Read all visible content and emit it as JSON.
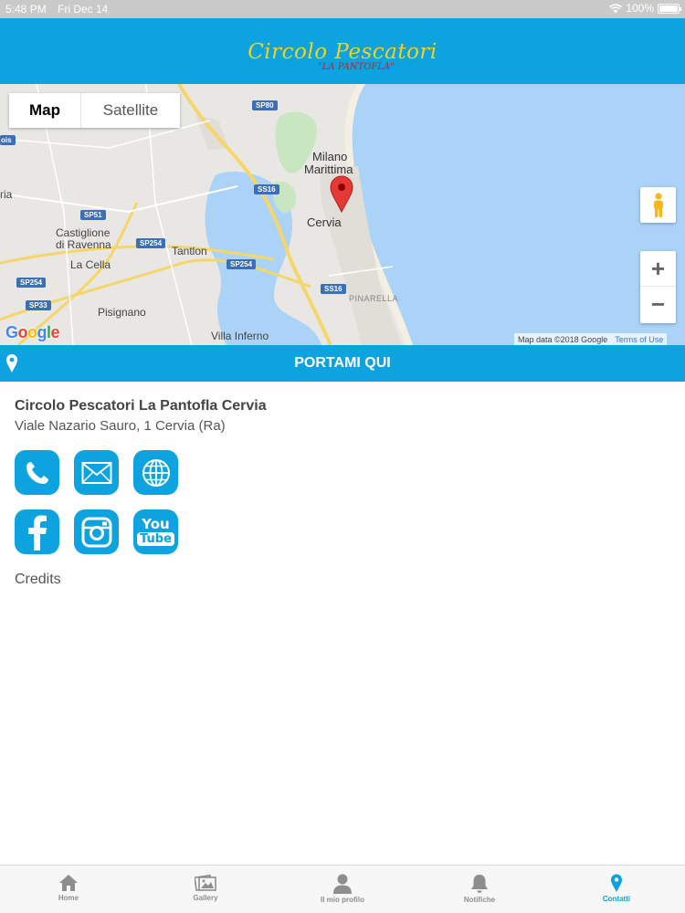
{
  "status_bar": {
    "time": "5:48 PM",
    "date": "Fri Dec 14",
    "battery": "100%",
    "battery_level": 1.0
  },
  "header": {
    "logo_title": "Circolo Pescatori",
    "logo_subtitle": "\"LA PANTOFLA\"",
    "background": "#0ca3de",
    "logo_color": "#f2d21a"
  },
  "map": {
    "type_map": "Map",
    "type_satellite": "Satellite",
    "selected_type": "Map",
    "places": {
      "milano": "Milano",
      "marittima": "Marittima",
      "cervia": "Cervia",
      "castiglione": "Castiglione",
      "di_ravenna": "di Ravenna",
      "tantlon": "Tantlon",
      "la_cella": "La Cella",
      "pisignano": "Pisignano",
      "villa_inferno": "Villa Inferno",
      "pinarella": "PINARELLA",
      "ria": "ria",
      "ois": "ois"
    },
    "roads": {
      "sp80": "SP80",
      "ss16_a": "SS16",
      "sp51": "SP51",
      "sp254_a": "SP254",
      "sp254_b": "SP254",
      "sp254_c": "SP254",
      "ss16_b": "SS16",
      "sp33": "SP33"
    },
    "zoom_in": "+",
    "zoom_out": "−",
    "attribution": "Map data ©2018 Google",
    "terms": "Terms of Use",
    "brand": {
      "g": "G",
      "o1": "o",
      "o2": "o",
      "g2": "g",
      "l": "l",
      "e": "e"
    },
    "water_color": "#abd3f7",
    "land_color": "#e9e7e3",
    "marker_color": "#e53935"
  },
  "directions": {
    "label": "PORTAMI QUI"
  },
  "contact": {
    "name": "Circolo Pescatori La Pantofla Cervia",
    "address": "Viale Nazario Sauro, 1 Cervia (Ra)",
    "icons": [
      "phone-icon",
      "mail-icon",
      "globe-icon",
      "facebook-icon",
      "instagram-icon",
      "youtube-icon"
    ],
    "youtube_top": "You",
    "youtube_bottom": "Tube",
    "credits": "Credits",
    "accent": "#0ca3de"
  },
  "tabbar": {
    "active": "Contatti",
    "items": [
      {
        "label": "Home",
        "icon": "home-icon"
      },
      {
        "label": "Gallery",
        "icon": "gallery-icon"
      },
      {
        "label": "Il mio profilo",
        "icon": "profile-icon"
      },
      {
        "label": "Notifiche",
        "icon": "bell-icon"
      },
      {
        "label": "Contatti",
        "icon": "location-pin-icon"
      }
    ]
  }
}
